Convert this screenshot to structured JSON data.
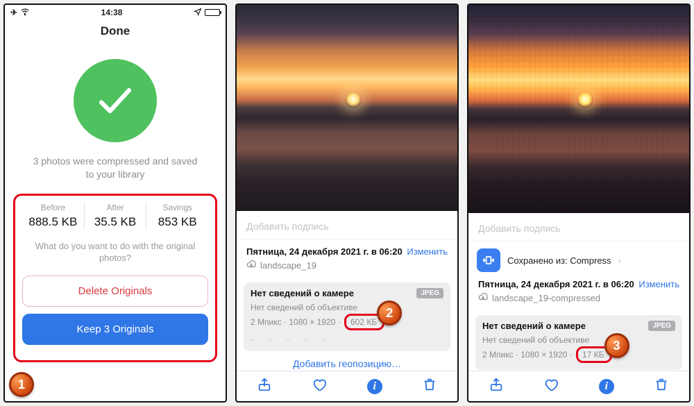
{
  "status": {
    "time": "14:38"
  },
  "screen1": {
    "title": "Done",
    "message": "3 photos were compressed and saved to your library",
    "stats": {
      "before_label": "Before",
      "before_value": "888.5 KB",
      "after_label": "After",
      "after_value": "35.5 KB",
      "savings_label": "Savings",
      "savings_value": "853 KB"
    },
    "prompt": "What do you want to do with the original photos?",
    "delete_label": "Delete Originals",
    "keep_label": "Keep 3 Originals",
    "badge": "1"
  },
  "screen2": {
    "caption_placeholder": "Добавить подпись",
    "date": "Пятница, 24 декабря 2021 г. в 06:20",
    "edit": "Изменить",
    "filename": "landscape_19",
    "camera_header": "Нет сведений о камере",
    "jpeg": "JPEG",
    "lens_line": "Нет сведений об объективе",
    "res_line_prefix": "2 Мпикс · 1080 × 1920 ·",
    "size": "602 КБ",
    "dash": "-",
    "geo": "Добавить геопозицию…",
    "badge": "2"
  },
  "screen3": {
    "caption_placeholder": "Добавить подпись",
    "origin": "Сохранено из: Compress",
    "date": "Пятница, 24 декабря 2021 г. в 06:20",
    "edit": "Изменить",
    "filename": "landscape_19-compressed",
    "camera_header": "Нет сведений о камере",
    "jpeg": "JPEG",
    "lens_line": "Нет сведений об объективе",
    "res_line_prefix": "2 Мпикс · 1080 × 1920 ·",
    "size": "17 КБ",
    "badge": "3"
  }
}
